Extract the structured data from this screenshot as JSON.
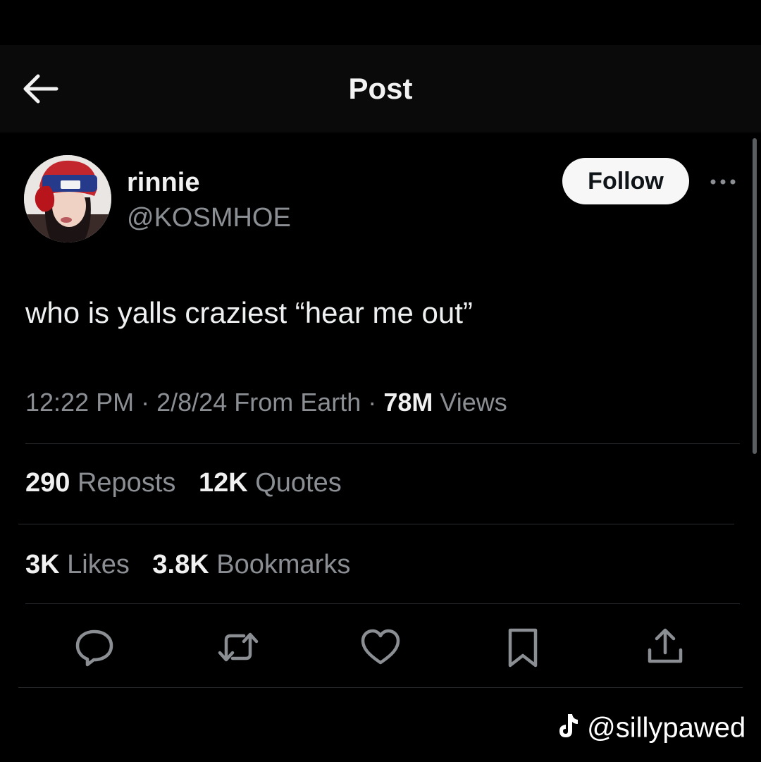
{
  "header": {
    "title": "Post"
  },
  "post": {
    "display_name": "rinnie",
    "handle": "@KOSMHOE",
    "follow_label": "Follow",
    "text": "who is yalls craziest “hear me out”",
    "time": "12:22 PM",
    "separator": "·",
    "date": "2/8/24",
    "location": "From Earth",
    "views_count": "78M",
    "views_label": "Views"
  },
  "stats": {
    "reposts_count": "290",
    "reposts_label": "Reposts",
    "quotes_count": "12K",
    "quotes_label": "Quotes",
    "likes_count": "3K",
    "likes_label": "Likes",
    "bookmarks_count": "3.8K",
    "bookmarks_label": "Bookmarks"
  },
  "actions": [
    "reply-icon",
    "repost-icon",
    "heart-icon",
    "bookmark-icon",
    "share-icon"
  ],
  "watermark": {
    "text": "@sillypawed"
  },
  "colors": {
    "background": "#000000",
    "text_primary": "#e7e9ea",
    "text_secondary": "#8b8f94",
    "follow_button_bg": "#f7f7f7"
  }
}
